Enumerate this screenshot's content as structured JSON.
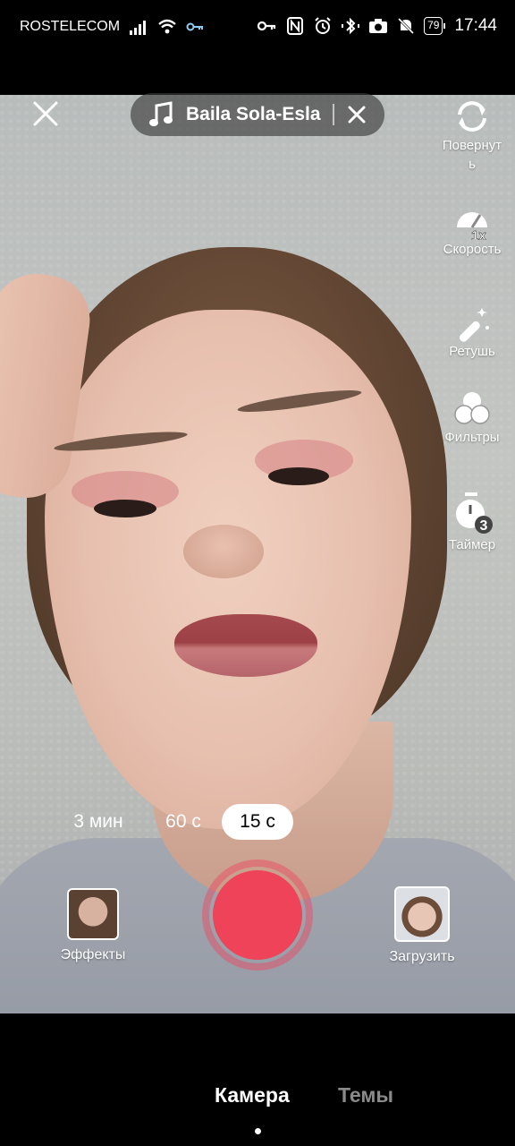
{
  "status_bar": {
    "carrier": "ROSTELECOM",
    "battery": "79",
    "time": "17:44"
  },
  "top": {
    "sound_title": "Baila Sola-Esla"
  },
  "tools": {
    "flip_label": "Повернуть",
    "speed_badge": "1x",
    "speed_label": "Скорость",
    "retouch_label": "Ретушь",
    "filters_label": "Фильтры",
    "timer_badge": "3",
    "timer_label": "Таймер"
  },
  "durations": {
    "options": [
      "3 мин",
      "60 с",
      "15 с"
    ],
    "selected": "15 с"
  },
  "controls": {
    "effects_label": "Эффекты",
    "upload_label": "Загрузить"
  },
  "tabs": {
    "camera": "Камера",
    "themes": "Темы"
  },
  "colors": {
    "record": "#ee4359",
    "pill_bg": "#3c3c3c"
  }
}
